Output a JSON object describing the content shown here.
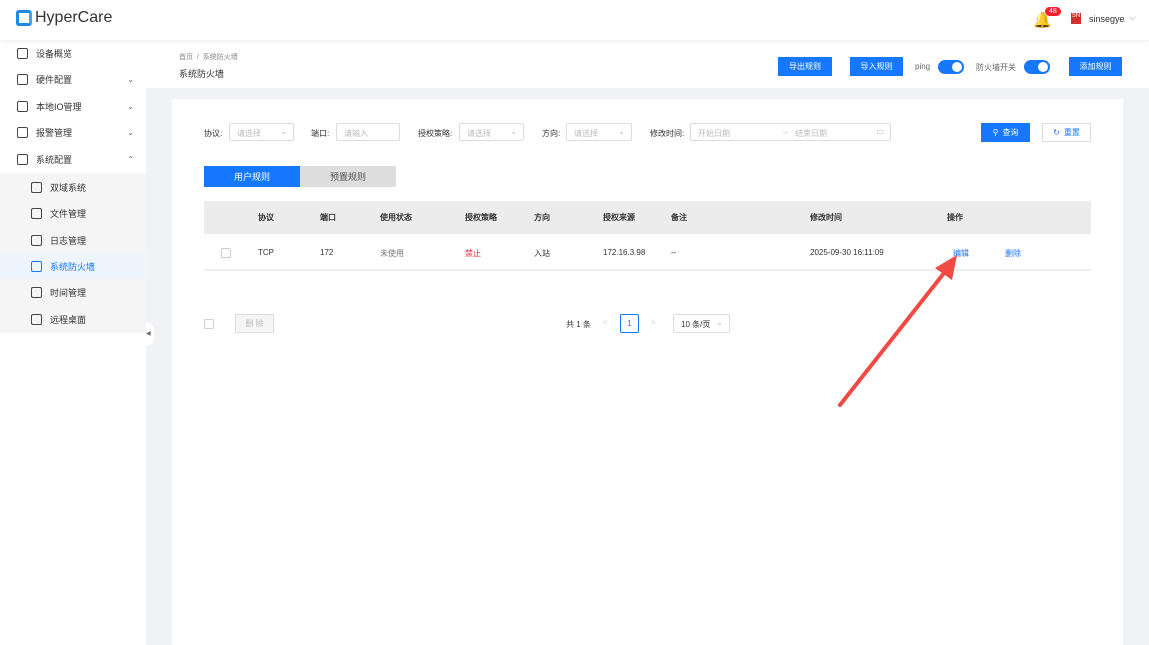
{
  "app": {
    "title": "HyperCare",
    "notifications": "48",
    "user": "sinsegye"
  },
  "sidebar": {
    "items": [
      {
        "label": "设备概览"
      },
      {
        "label": "硬件配置"
      },
      {
        "label": "本地IO管理"
      },
      {
        "label": "报警管理"
      },
      {
        "label": "系统配置"
      },
      {
        "label": "双域系统"
      },
      {
        "label": "文件管理"
      },
      {
        "label": "日志管理"
      },
      {
        "label": "系统防火墙"
      },
      {
        "label": "时间管理"
      },
      {
        "label": "远程桌面"
      }
    ]
  },
  "header": {
    "breadcrumb": "首页  /  系统防火墙",
    "title": "系统防火墙",
    "export": "导出规则",
    "import": "导入规则",
    "ping": "ping",
    "firewall_switch": "防火墙开关",
    "add": "添加规则",
    "ping_on": true,
    "firewall_on": true
  },
  "filters": {
    "protocol_label": "协议:",
    "protocol_ph": "请选择",
    "port_label": "端口:",
    "port_ph": "请输入",
    "policy_label": "授权策略:",
    "policy_ph": "请选择",
    "direction_label": "方向:",
    "direction_ph": "请选择",
    "time_label": "修改时间:",
    "start_ph": "开始日期",
    "end_ph": "结束日期",
    "query": "查询",
    "reset": "重置"
  },
  "tabs": [
    {
      "label": "用户规则"
    },
    {
      "label": "预置规则"
    }
  ],
  "table": {
    "headers": [
      "协议",
      "端口",
      "使用状态",
      "授权策略",
      "方向",
      "授权来源",
      "备注",
      "修改时间",
      "操作"
    ],
    "rows": [
      {
        "protocol": "TCP",
        "port": "172",
        "status": "未使用",
        "policy": "禁止",
        "direction": "入站",
        "source": "172.16.3.98",
        "note": "--",
        "time": "2025-09-30 16:11:09",
        "edit": "编辑",
        "delete": "删除"
      }
    ]
  },
  "footer": {
    "delete": "删 除",
    "total": "共 1 条",
    "page": "1",
    "page_size": "10 条/页"
  },
  "colors": {
    "primary": "#1677ff",
    "danger": "#f5222d",
    "arrow": "#f04a43"
  }
}
